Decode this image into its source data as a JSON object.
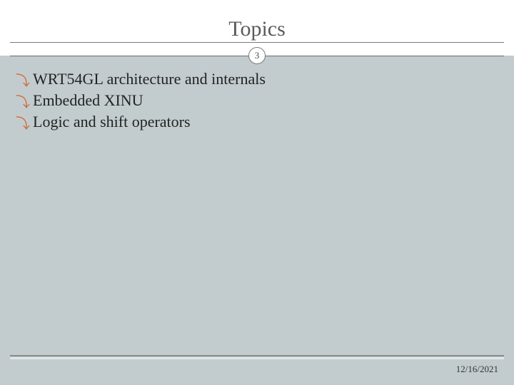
{
  "title": "Topics",
  "page_number": "3",
  "bullets": [
    "WRT54GL architecture and internals",
    "Embedded XINU",
    "Logic and shift operators"
  ],
  "date": "12/16/2021"
}
